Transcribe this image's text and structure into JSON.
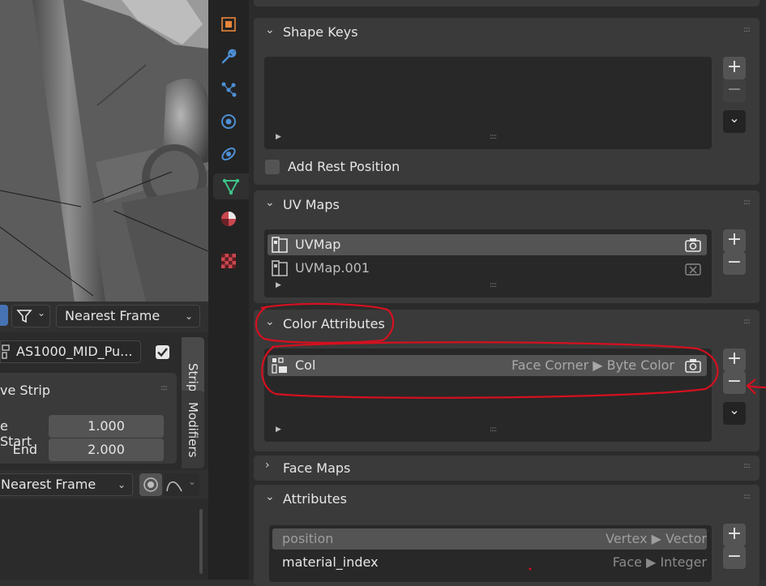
{
  "nla": {
    "snap_mode": "Nearest Frame",
    "action_name": "AS1000_MID_Pu...",
    "section_title": "ve Strip",
    "frame_start_label": "e Start",
    "frame_start_value": "1.000",
    "frame_end_label": "End",
    "frame_end_value": "2.000",
    "interpolation": "Nearest Frame",
    "tab_strip": "Strip",
    "tab_modifiers": "Modifiers"
  },
  "properties": {
    "tabs": [
      "object",
      "modifiers",
      "particles",
      "physics",
      "constraints",
      "data",
      "material",
      "texture"
    ],
    "active_tab": "data",
    "shape_keys": {
      "title": "Shape Keys",
      "add_rest_position": "Add Rest Position"
    },
    "uv_maps": {
      "title": "UV Maps",
      "items": [
        {
          "name": "UVMap",
          "selected": true
        },
        {
          "name": "UVMap.001",
          "selected": false
        }
      ]
    },
    "color_attributes": {
      "title": "Color Attributes",
      "items": [
        {
          "name": "Col",
          "domain": "Face Corner ▶ Byte Color",
          "selected": true
        }
      ]
    },
    "face_maps": {
      "title": "Face Maps"
    },
    "attributes": {
      "title": "Attributes",
      "items": [
        {
          "name": "position",
          "domain": "Vertex ▶ Vector",
          "selected": true
        },
        {
          "name": "material_index",
          "domain": "Face ▶ Integer",
          "selected": false
        }
      ]
    }
  },
  "colors": {
    "accent_orange": "#e8853a",
    "accent_blue": "#4d8fd6",
    "accent_green": "#3ec48a",
    "annotation_red": "#d5101f"
  },
  "icons": {
    "plus": "+",
    "minus": "−",
    "chevron_down": "⌄",
    "play": "▶"
  }
}
